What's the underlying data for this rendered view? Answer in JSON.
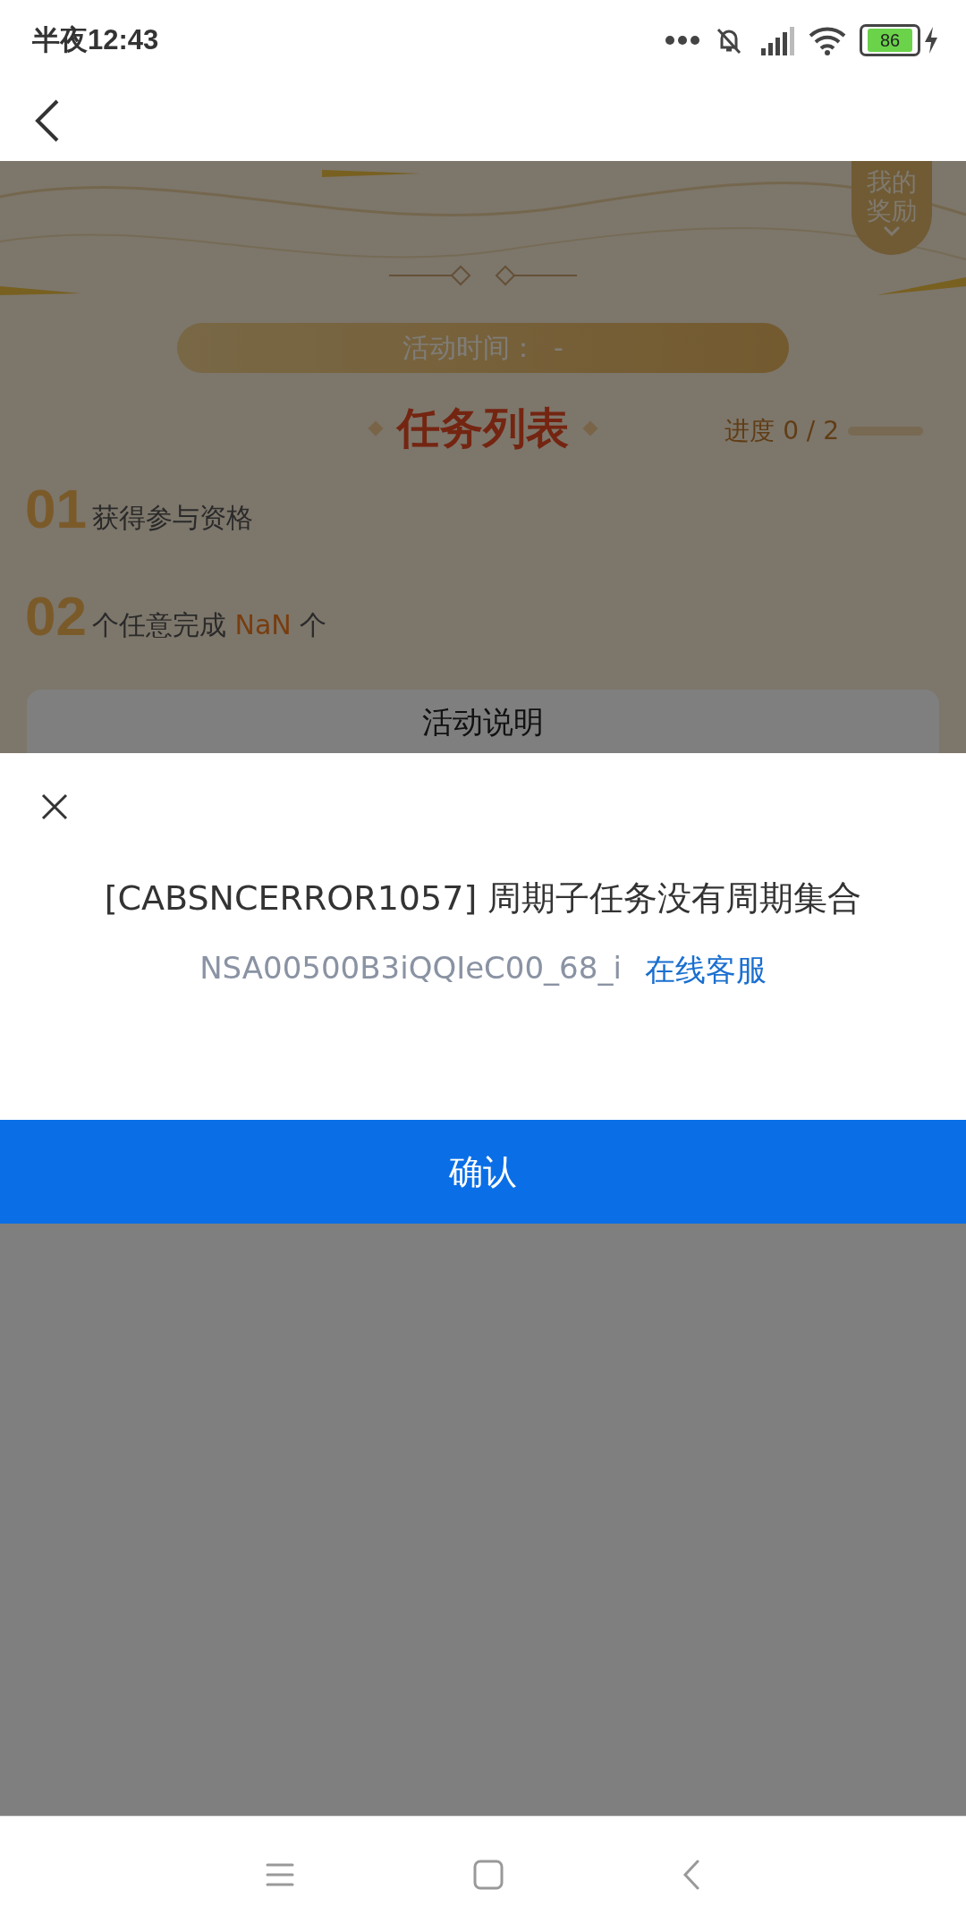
{
  "status_bar": {
    "time": "半夜12:43",
    "battery": "86"
  },
  "page": {
    "reward_badge": "我的奖励",
    "activity_time": "活动时间：  -",
    "task_list": {
      "title": "任务列表",
      "progress_label": "进度 0 / 2",
      "level": 0
    },
    "tasks": [
      {
        "number": "01",
        "text": "获得参与资格"
      },
      {
        "number": "02",
        "text": "个任意完成",
        "highlight": "NaN",
        "suffix": "个"
      }
    ],
    "description_title": "活动说明"
  },
  "dialog": {
    "title": "[CABSNCERROR1057] 周期子任务没有周期集合",
    "request_id": "NSA00500B3iQQIeC00_68_i",
    "link": "在线客服",
    "confirm": "确认"
  }
}
